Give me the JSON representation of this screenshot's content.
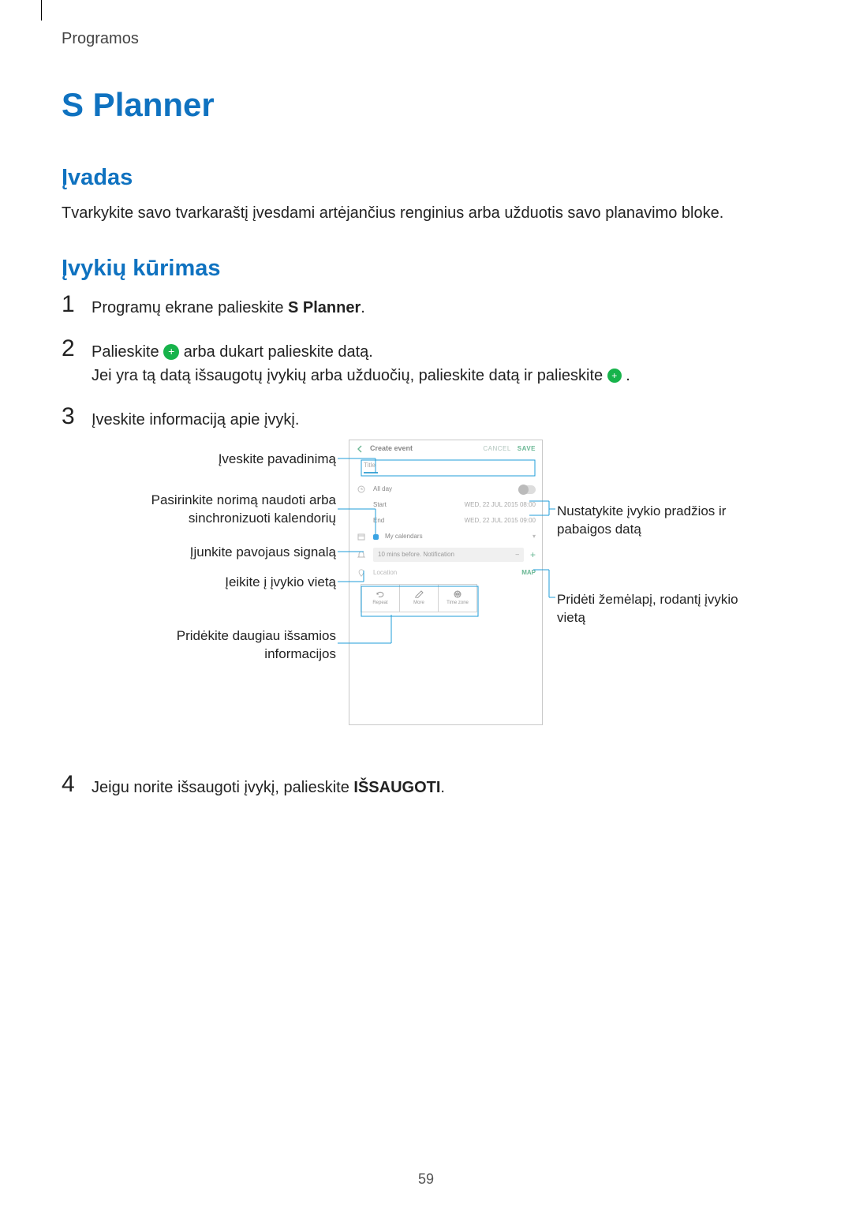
{
  "breadcrumb": "Programos",
  "title": "S Planner",
  "sections": {
    "intro": {
      "heading": "Įvadas",
      "paragraph": "Tvarkykite savo tvarkaraštį įvesdami artėjančius renginius arba užduotis savo planavimo bloke."
    },
    "events": {
      "heading": "Įvykių kūrimas",
      "steps": {
        "1": {
          "pre": "Programų ekrane palieskite ",
          "bold": "S Planner",
          "post": "."
        },
        "2": {
          "a_pre": "Palieskite ",
          "a_post": " arba dukart palieskite datą.",
          "b_pre": "Jei yra tą datą išsaugotų įvykių arba užduočių, palieskite datą ir palieskite ",
          "b_post": "."
        },
        "3": {
          "text": "Įveskite informaciją apie įvykį."
        },
        "4": {
          "pre": "Jeigu norite išsaugoti įvykį, palieskite ",
          "bold": "IŠSAUGOTI",
          "post": "."
        }
      }
    }
  },
  "diagram": {
    "left": {
      "title_input": "Įveskite pavadinimą",
      "calendar": "Pasirinkite norimą naudoti arba sinchronizuoti kalendorių",
      "alarm": "Įjunkite pavojaus signalą",
      "goto_location": "Įeikite į įvykio vietą",
      "more_info": "Pridėkite daugiau išsamios informacijos"
    },
    "right": {
      "dates": "Nustatykite įvykio pradžios ir pabaigos datą",
      "map": "Pridėti žemėlapį, rodantį įvykio vietą"
    },
    "phone": {
      "create": "Create event",
      "cancel": "CANCEL",
      "save": "SAVE",
      "title_placeholder": "Title",
      "all_day": "All day",
      "start": "Start",
      "end": "End",
      "start_val": "WED, 22 JUL 2015   08:00",
      "end_val": "WED, 22 JUL 2015   09:00",
      "my_calendars": "My calendars",
      "notif": "10 mins before. Notification",
      "location": "Location",
      "map": "MAP",
      "tab_repeat": "Repeat",
      "tab_more": "More",
      "tab_timezone": "Time zone"
    }
  },
  "page_number": "59"
}
